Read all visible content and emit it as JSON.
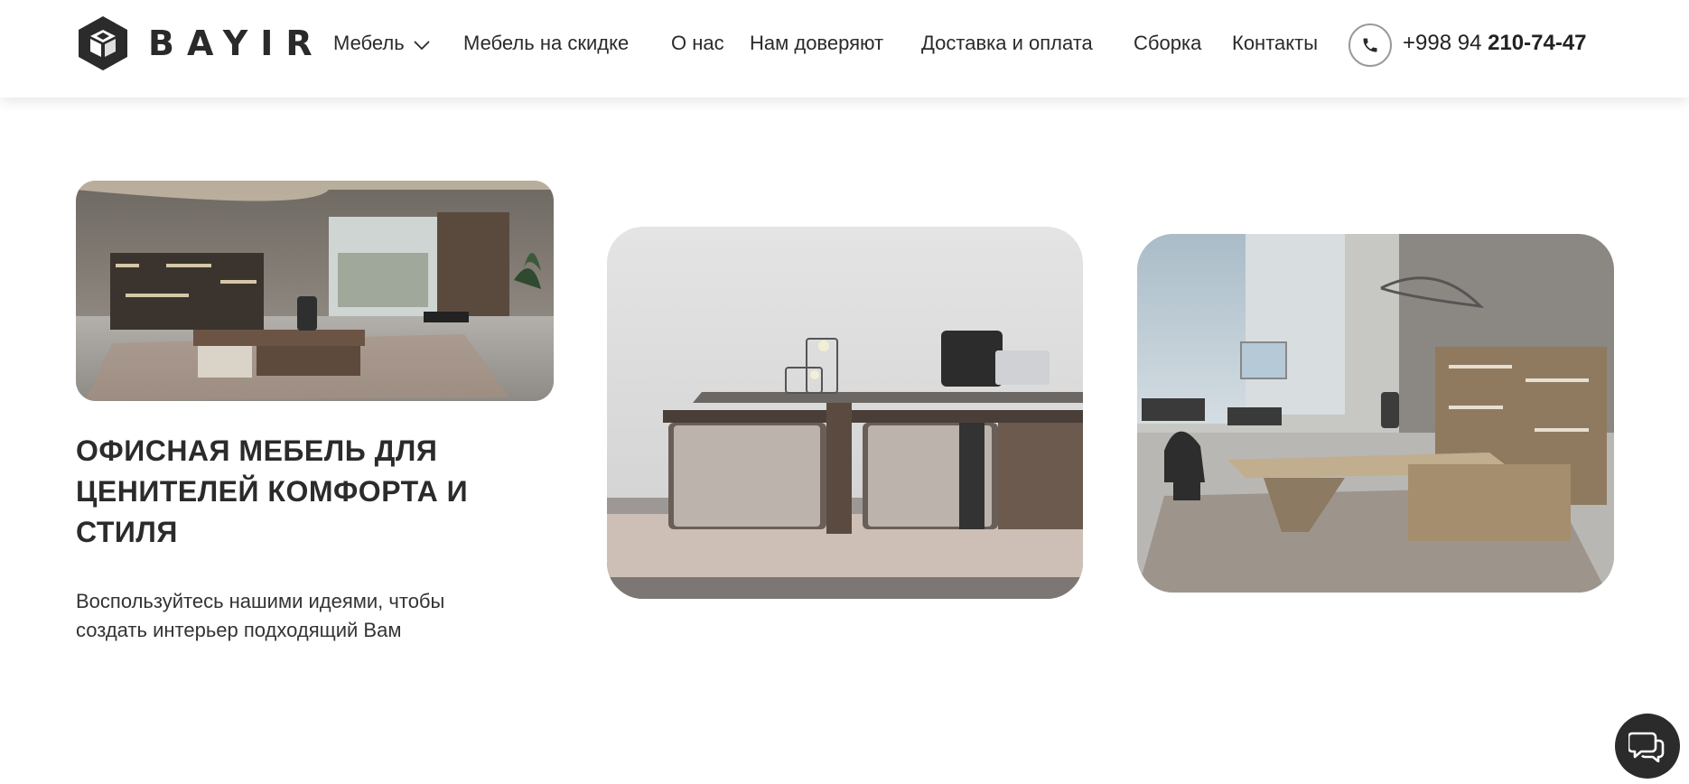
{
  "brand": {
    "name": "BAYIR"
  },
  "nav": {
    "items": [
      {
        "label": "Мебель",
        "has_dropdown": true
      },
      {
        "label": "Мебель на скидке"
      },
      {
        "label": "О нас"
      },
      {
        "label": "Нам доверяют"
      },
      {
        "label": "Доставка и оплата"
      },
      {
        "label": "Сборка"
      },
      {
        "label": "Контакты"
      }
    ]
  },
  "contact": {
    "phone_prefix": "+998 94",
    "phone_main": "210-74-47",
    "icon": "phone-icon"
  },
  "hero": {
    "title": "ОФИСНАЯ МЕБЕЛЬ ДЛЯ ЦЕНИТЕЛЕЙ КОМФОРТА И СТИЛЯ",
    "subtitle": "Воспользуйтесь нашими идеями, чтобы создать интерьер подходящий Вам"
  },
  "images": [
    {
      "icon": "office-interior-image"
    },
    {
      "icon": "executive-desk-image"
    },
    {
      "icon": "office-workspace-image"
    }
  ],
  "chat": {
    "icon": "chat-icon"
  },
  "colors": {
    "text": "#2a2a2a",
    "accent_dark": "#2b2b2b",
    "background": "#ffffff",
    "border_gray": "#9a9a9a"
  }
}
